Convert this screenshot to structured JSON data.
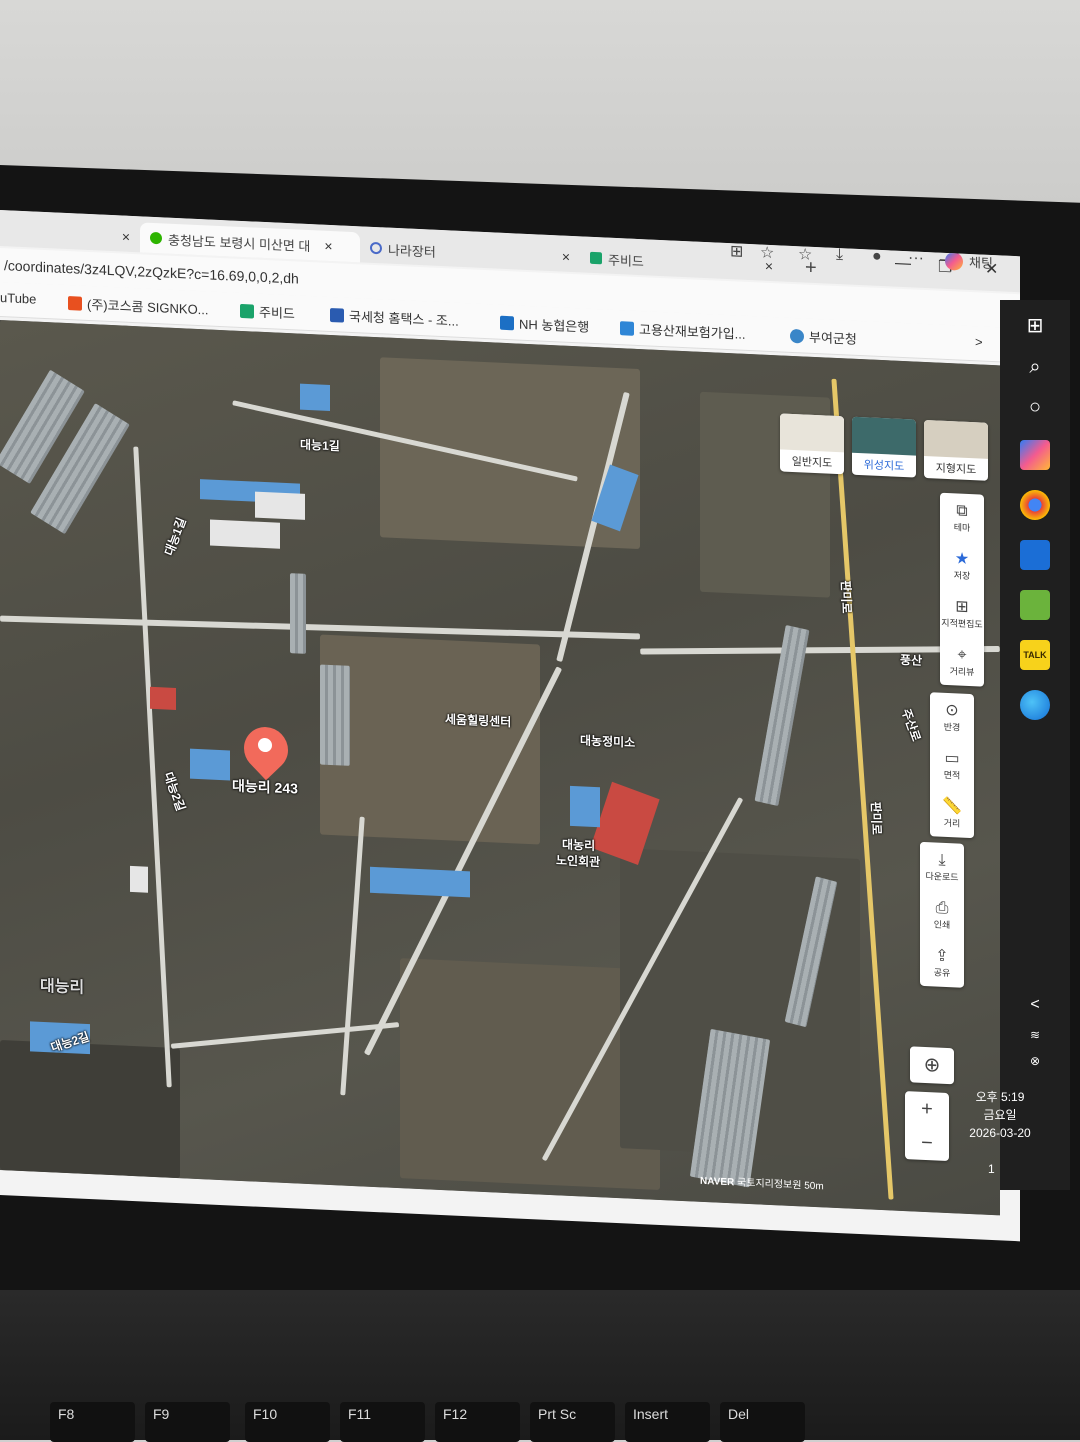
{
  "browser": {
    "tabs": [
      {
        "label": "",
        "close": "×"
      },
      {
        "label": "충청남도 보령시 미산면 대",
        "close": "×"
      },
      {
        "label": "나라장터",
        "close": "×"
      },
      {
        "label": "주비드",
        "close": "×"
      }
    ],
    "new_tab": "+",
    "address": "/coordinates/3z4LQV,2zQzkE?c=16.69,0,0,2,dh",
    "bookmarks": [
      {
        "label": "uTube"
      },
      {
        "label": "(주)코스콤 SIGNKO..."
      },
      {
        "label": "주비드"
      },
      {
        "label": "국세청 홈택스 - 조..."
      },
      {
        "label": "NH 농협은행"
      },
      {
        "label": "고용산재보험가입..."
      },
      {
        "label": "부여군청"
      }
    ],
    "toolbar_chat": "채팅",
    "more": "···",
    "bookmark_next": ">"
  },
  "map": {
    "labels": {
      "road1": "대능1길",
      "road2": "대능1길",
      "road3": "대능2길",
      "road4": "대능2길",
      "road5": "판미로",
      "road6": "판미로",
      "road7": "풍산",
      "road8": "주산로",
      "village": "대능리",
      "poi1": "세움힐링센터",
      "poi2": "대농정미소",
      "poi3": "대농리",
      "poi3b": "노인회관",
      "marker": "대능리 243"
    },
    "map_types": [
      "일반지도",
      "위성지도",
      "지형지도"
    ],
    "side_tools": [
      {
        "label": "테마",
        "icon": "layers-icon"
      },
      {
        "label": "저장",
        "icon": "star-icon"
      },
      {
        "label": "지적편집도",
        "icon": "cadastral-icon"
      },
      {
        "label": "거리뷰",
        "icon": "streetview-icon"
      },
      {
        "label": "반경",
        "icon": "radius-icon"
      },
      {
        "label": "면적",
        "icon": "area-icon"
      },
      {
        "label": "거리",
        "icon": "ruler-icon"
      },
      {
        "label": "다운로드",
        "icon": "download-icon"
      },
      {
        "label": "인쇄",
        "icon": "print-icon"
      },
      {
        "label": "공유",
        "icon": "share-icon"
      }
    ],
    "zoom_in": "+",
    "zoom_out": "−",
    "attribution_brand": "NAVER",
    "attribution_text": "국토지리정보원",
    "scale": "50m"
  },
  "taskbar": {
    "chevron": "<",
    "clock_time": "오후 5:19",
    "clock_day": "금요일",
    "clock_date": "2026-03-20",
    "notification_count": "1"
  },
  "keyboard": {
    "keys": [
      "F8",
      "F9",
      "F10",
      "F11",
      "F12",
      "Prt Sc",
      "Insert",
      "Del"
    ]
  }
}
